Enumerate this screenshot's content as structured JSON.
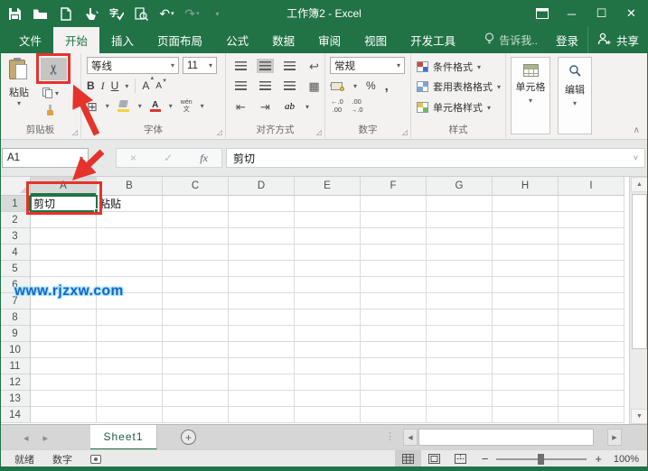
{
  "window": {
    "title": "工作簿2 - Excel"
  },
  "quick_access": {
    "icons": [
      "save",
      "open-folder",
      "new-document",
      "touch-mode",
      "spell-check",
      "print-preview",
      "undo",
      "redo",
      "customize-qat"
    ]
  },
  "tabs": {
    "items": [
      {
        "label": "文件",
        "active": false
      },
      {
        "label": "开始",
        "active": true
      },
      {
        "label": "插入",
        "active": false
      },
      {
        "label": "页面布局",
        "active": false
      },
      {
        "label": "公式",
        "active": false
      },
      {
        "label": "数据",
        "active": false
      },
      {
        "label": "审阅",
        "active": false
      },
      {
        "label": "视图",
        "active": false
      },
      {
        "label": "开发工具",
        "active": false
      }
    ],
    "tell_me": "告诉我..",
    "sign_in": "登录",
    "share": "共享"
  },
  "ribbon": {
    "clipboard": {
      "group_label": "剪贴板",
      "paste_label": "粘贴",
      "cut_glyph": "✂"
    },
    "font": {
      "group_label": "字体",
      "font_name": "等线",
      "font_size": "11",
      "bold": "B",
      "italic": "I",
      "underline": "U",
      "grow": "A",
      "shrink": "A",
      "phonetic": "wén\n文"
    },
    "alignment": {
      "group_label": "对齐方式",
      "wrap_glyph": "↩",
      "merge_glyph": "▦",
      "indent_dec": "⇤",
      "indent_inc": "⇥",
      "orientation": "ab"
    },
    "number": {
      "group_label": "数字",
      "format": "常规",
      "percent": "%",
      "comma": ",",
      "inc_decimal": "←.0\n.00",
      "dec_decimal": ".00\n→.0"
    },
    "styles": {
      "group_label": "样式",
      "items": [
        "条件格式",
        "套用表格格式",
        "单元格样式"
      ]
    },
    "cells": {
      "label": "单元格"
    },
    "editing": {
      "label": "编辑"
    }
  },
  "formula_bar": {
    "name_box": "A1",
    "cancel": "×",
    "enter": "✓",
    "fx": "fx",
    "value": "剪切"
  },
  "grid": {
    "columns": [
      "A",
      "B",
      "C",
      "D",
      "E",
      "F",
      "G",
      "H",
      "I"
    ],
    "row_count": 14,
    "cells": {
      "A1": "剪切",
      "B1": "粘贴"
    },
    "selection": "A1",
    "watermark": "www.rjzxw.com"
  },
  "sheet_bar": {
    "tabs": [
      {
        "name": "Sheet1",
        "active": true
      }
    ]
  },
  "status_bar": {
    "mode": "就绪",
    "num_lock": "数字",
    "zoom_level": "100%"
  },
  "colors": {
    "accent": "#217346",
    "annotation_red": "#e5332c",
    "watermark_blue": "#1565c8",
    "fill_yellow": "#f5d23c",
    "font_color_red": "#d53a2d"
  }
}
